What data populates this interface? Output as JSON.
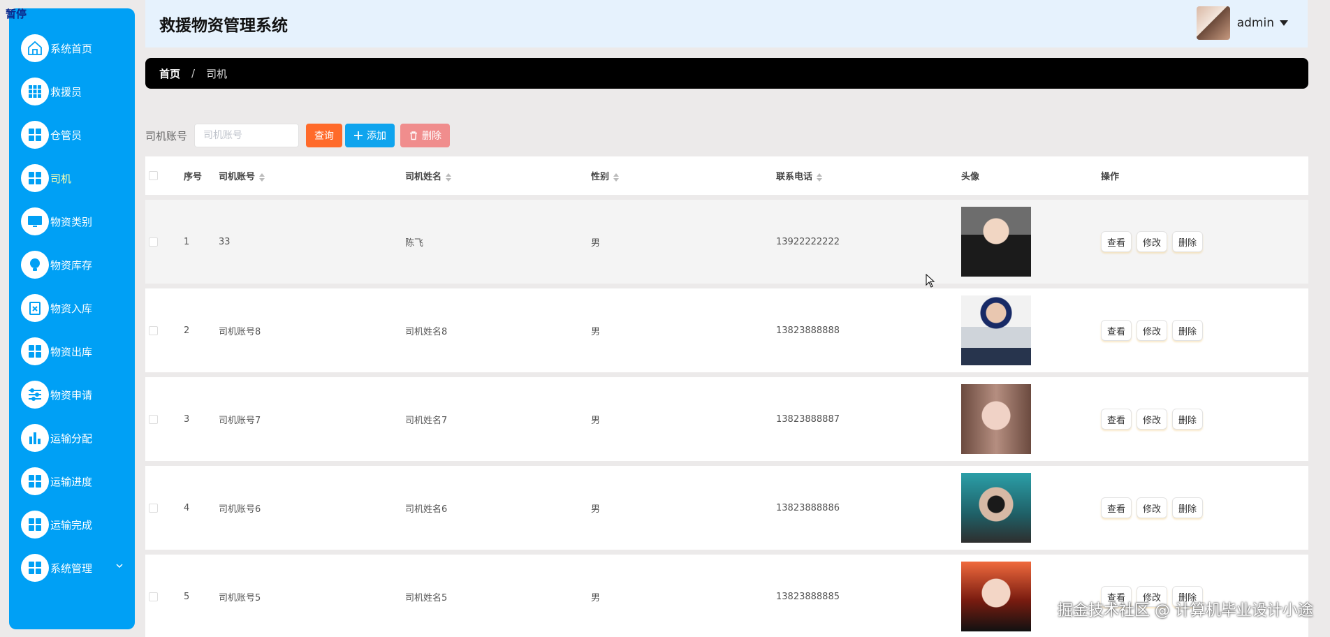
{
  "paused_label": "暂停",
  "header": {
    "title": "救援物资管理系统",
    "user": "admin"
  },
  "sidebar": {
    "items": [
      {
        "label": "系统首页",
        "icon": "home-icon"
      },
      {
        "label": "救援员",
        "icon": "grid-icon"
      },
      {
        "label": "仓管员",
        "icon": "grid-icon"
      },
      {
        "label": "司机",
        "icon": "grid-icon",
        "active": true
      },
      {
        "label": "物资类别",
        "icon": "monitor-icon"
      },
      {
        "label": "物资库存",
        "icon": "bulb-icon"
      },
      {
        "label": "物资入库",
        "icon": "clipboard-icon"
      },
      {
        "label": "物资出库",
        "icon": "grid-icon"
      },
      {
        "label": "物资申请",
        "icon": "sliders-icon"
      },
      {
        "label": "运输分配",
        "icon": "bar-chart-icon"
      },
      {
        "label": "运输进度",
        "icon": "grid-icon"
      },
      {
        "label": "运输完成",
        "icon": "grid-icon"
      },
      {
        "label": "系统管理",
        "icon": "grid-icon",
        "has_children": true
      }
    ]
  },
  "breadcrumb": {
    "home": "首页",
    "separator": "/",
    "current": "司机"
  },
  "search": {
    "label": "司机账号",
    "placeholder": "司机账号",
    "query_label": "查询",
    "add_label": "添加",
    "delete_label": "删除"
  },
  "table": {
    "headers": {
      "index": "序号",
      "account": "司机账号",
      "name": "司机姓名",
      "gender": "性别",
      "phone": "联系电话",
      "avatar": "头像",
      "actions": "操作"
    },
    "actions": {
      "view": "查看",
      "edit": "修改",
      "delete": "删除"
    },
    "rows": [
      {
        "index": "1",
        "account": "33",
        "name": "陈飞",
        "gender": "男",
        "phone": "13922222222"
      },
      {
        "index": "2",
        "account": "司机账号8",
        "name": "司机姓名8",
        "gender": "男",
        "phone": "13823888888"
      },
      {
        "index": "3",
        "account": "司机账号7",
        "name": "司机姓名7",
        "gender": "男",
        "phone": "13823888887"
      },
      {
        "index": "4",
        "account": "司机账号6",
        "name": "司机姓名6",
        "gender": "男",
        "phone": "13823888886"
      },
      {
        "index": "5",
        "account": "司机账号5",
        "name": "司机姓名5",
        "gender": "男",
        "phone": "13823888885"
      }
    ]
  },
  "watermark": "掘金技术社区 @ 计算机毕业设计小途",
  "colors": {
    "sidebar": "#00a0f5",
    "query": "#ff6a2a",
    "add": "#0fa4ee",
    "delete": "#f08d8d",
    "active_menu": "#faffb0"
  }
}
